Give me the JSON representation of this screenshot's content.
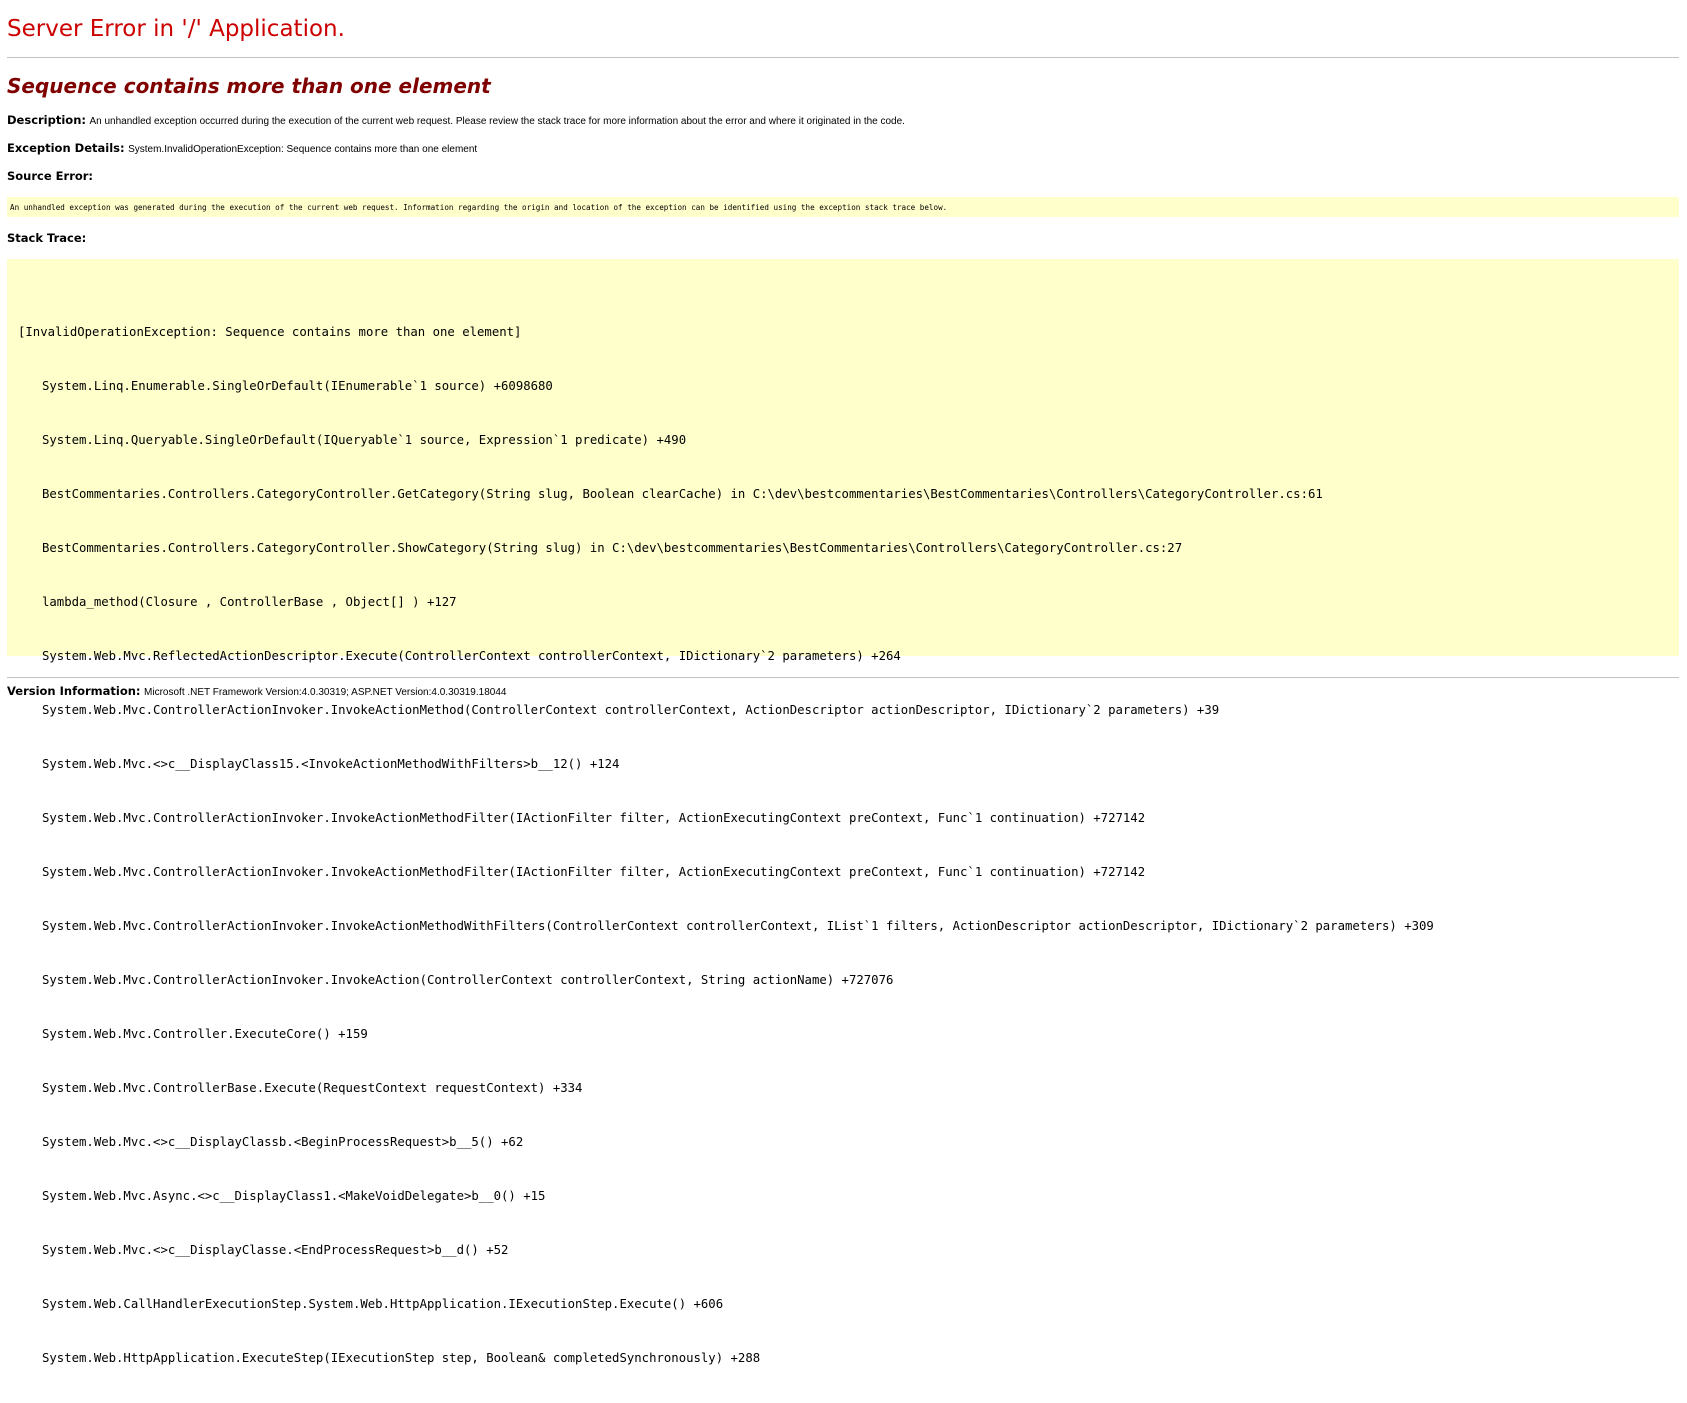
{
  "header": {
    "title": "Server Error in '/' Application.",
    "subtitle": "Sequence contains more than one element"
  },
  "description": {
    "label": "Description:",
    "text": "An unhandled exception occurred during the execution of the current web request. Please review the stack trace for more information about the error and where it originated in the code."
  },
  "exception_details": {
    "label": "Exception Details:",
    "text": "System.InvalidOperationException: Sequence contains more than one element"
  },
  "source_error": {
    "label": "Source Error:",
    "text": "An unhandled exception was generated during the execution of the current web request. Information regarding the origin and location of the exception can be identified using the exception stack trace below."
  },
  "stack_trace": {
    "label": "Stack Trace:",
    "header_line": "[InvalidOperationException: Sequence contains more than one element]",
    "lines": [
      "System.Linq.Enumerable.SingleOrDefault(IEnumerable`1 source) +6098680",
      "System.Linq.Queryable.SingleOrDefault(IQueryable`1 source, Expression`1 predicate) +490",
      "BestCommentaries.Controllers.CategoryController.GetCategory(String slug, Boolean clearCache) in C:\\dev\\bestcommentaries\\BestCommentaries\\Controllers\\CategoryController.cs:61",
      "BestCommentaries.Controllers.CategoryController.ShowCategory(String slug) in C:\\dev\\bestcommentaries\\BestCommentaries\\Controllers\\CategoryController.cs:27",
      "lambda_method(Closure , ControllerBase , Object[] ) +127",
      "System.Web.Mvc.ReflectedActionDescriptor.Execute(ControllerContext controllerContext, IDictionary`2 parameters) +264",
      "System.Web.Mvc.ControllerActionInvoker.InvokeActionMethod(ControllerContext controllerContext, ActionDescriptor actionDescriptor, IDictionary`2 parameters) +39",
      "System.Web.Mvc.<>c__DisplayClass15.<InvokeActionMethodWithFilters>b__12() +124",
      "System.Web.Mvc.ControllerActionInvoker.InvokeActionMethodFilter(IActionFilter filter, ActionExecutingContext preContext, Func`1 continuation) +727142",
      "System.Web.Mvc.ControllerActionInvoker.InvokeActionMethodFilter(IActionFilter filter, ActionExecutingContext preContext, Func`1 continuation) +727142",
      "System.Web.Mvc.ControllerActionInvoker.InvokeActionMethodWithFilters(ControllerContext controllerContext, IList`1 filters, ActionDescriptor actionDescriptor, IDictionary`2 parameters) +309",
      "System.Web.Mvc.ControllerActionInvoker.InvokeAction(ControllerContext controllerContext, String actionName) +727076",
      "System.Web.Mvc.Controller.ExecuteCore() +159",
      "System.Web.Mvc.ControllerBase.Execute(RequestContext requestContext) +334",
      "System.Web.Mvc.<>c__DisplayClassb.<BeginProcessRequest>b__5() +62",
      "System.Web.Mvc.Async.<>c__DisplayClass1.<MakeVoidDelegate>b__0() +15",
      "System.Web.Mvc.<>c__DisplayClasse.<EndProcessRequest>b__d() +52",
      "System.Web.CallHandlerExecutionStep.System.Web.HttpApplication.IExecutionStep.Execute() +606",
      "System.Web.HttpApplication.ExecuteStep(IExecutionStep step, Boolean& completedSynchronously) +288"
    ]
  },
  "version_information": {
    "label": "Version Information:",
    "text": "Microsoft .NET Framework Version:4.0.30319; ASP.NET Version:4.0.30319.18044"
  },
  "colors": {
    "title": "#cc0000",
    "subtitle": "#800000",
    "code_background": "#ffffcc",
    "rule": "#c0c0c0"
  }
}
